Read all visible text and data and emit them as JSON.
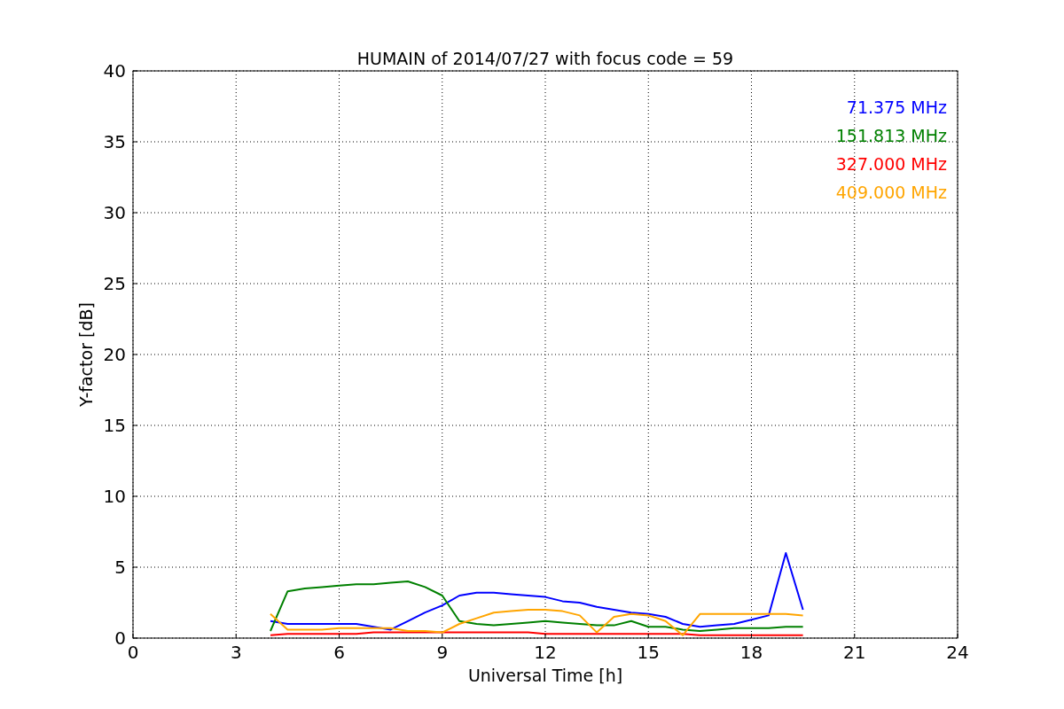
{
  "figure": {
    "chart_data": {
      "type": "line",
      "title": "HUMAIN of 2014/07/27 with focus code = 59",
      "xlabel": "Universal Time [h]",
      "ylabel": "Y-factor [dB]",
      "x": [
        4,
        4.5,
        5,
        5.5,
        6,
        6.5,
        7,
        7.5,
        8,
        8.5,
        9,
        9.5,
        10,
        10.5,
        11,
        11.5,
        12,
        12.5,
        13,
        13.5,
        14,
        14.5,
        15,
        15.5,
        16,
        16.5,
        17,
        17.5,
        18,
        18.5,
        19,
        19.5
      ],
      "series": [
        {
          "name": "71.375 MHz",
          "color": "#0000ff",
          "values": [
            1.2,
            1.0,
            1.0,
            1.0,
            1.0,
            1.0,
            0.8,
            0.6,
            1.2,
            1.8,
            2.3,
            3.0,
            3.2,
            3.2,
            3.1,
            3.0,
            2.9,
            2.6,
            2.5,
            2.2,
            2.0,
            1.8,
            1.7,
            1.5,
            1.0,
            0.8,
            0.9,
            1.0,
            1.3,
            1.6,
            6.0,
            2.0
          ]
        },
        {
          "name": "151.813 MHz",
          "color": "#008000",
          "values": [
            0.5,
            3.3,
            3.5,
            3.6,
            3.7,
            3.8,
            3.8,
            3.9,
            4.0,
            3.6,
            3.0,
            1.2,
            1.0,
            0.9,
            1.0,
            1.1,
            1.2,
            1.1,
            1.0,
            0.9,
            0.9,
            1.2,
            0.8,
            0.8,
            0.6,
            0.5,
            0.6,
            0.7,
            0.7,
            0.7,
            0.8,
            0.8
          ]
        },
        {
          "name": "327.000 MHz",
          "color": "#ff0000",
          "values": [
            0.2,
            0.3,
            0.3,
            0.3,
            0.3,
            0.3,
            0.4,
            0.4,
            0.4,
            0.4,
            0.4,
            0.4,
            0.4,
            0.4,
            0.4,
            0.4,
            0.3,
            0.3,
            0.3,
            0.3,
            0.3,
            0.3,
            0.3,
            0.3,
            0.3,
            0.2,
            0.2,
            0.2,
            0.2,
            0.2,
            0.2,
            0.2
          ]
        },
        {
          "name": "409.000 MHz",
          "color": "#ffa500",
          "values": [
            1.7,
            0.6,
            0.6,
            0.6,
            0.7,
            0.7,
            0.7,
            0.7,
            0.5,
            0.5,
            0.4,
            1.0,
            1.4,
            1.8,
            1.9,
            2.0,
            2.0,
            1.9,
            1.6,
            0.4,
            1.5,
            1.7,
            1.6,
            1.2,
            0.2,
            1.7,
            1.7,
            1.7,
            1.7,
            1.7,
            1.7,
            1.6
          ]
        }
      ],
      "grid": true,
      "xlim": [
        0,
        24
      ],
      "ylim": [
        0,
        40
      ],
      "xticks": [
        0,
        3,
        6,
        9,
        12,
        15,
        18,
        21,
        24
      ],
      "yticks": [
        0,
        5,
        10,
        15,
        20,
        25,
        30,
        35,
        40
      ]
    }
  }
}
